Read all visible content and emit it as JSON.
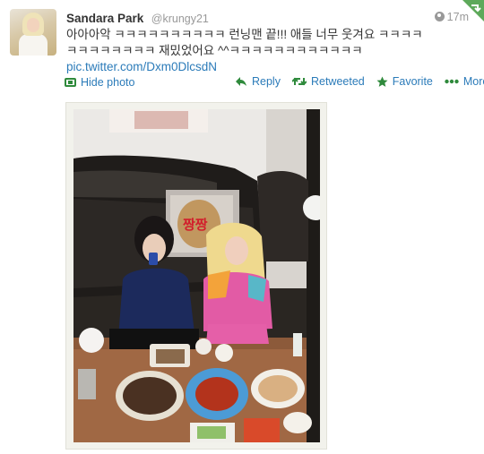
{
  "tweet": {
    "display_name": "Sandara Park",
    "screen_name": "@krungy21",
    "timestamp": "17m",
    "text_line1": "아아아악 ㅋㅋㅋㅋㅋㅋㅋㅋㅋㅋ 런닝맨 끝!!! 애들 너무 웃겨요 ㅋㅋㅋㅋ",
    "text_line2": "ㅋㅋㅋㅋㅋㅋㅋㅋ 재밌었어요 ^^ㅋㅋㅋㅋㅋㅋㅋㅋㅋㅋㅋㅋ",
    "link": "pic.twitter.com/Dxm0DlcsdN"
  },
  "photo_toggle": {
    "label": "Hide photo",
    "icon": "photo-icon"
  },
  "actions": [
    {
      "label": "Reply",
      "icon": "reply-arrow-icon",
      "color": "#2f8a3c"
    },
    {
      "label": "Retweeted",
      "icon": "retweet-icon",
      "color": "#2f8a3c"
    },
    {
      "label": "Favorite",
      "icon": "star-icon",
      "color": "#2f8a3c"
    },
    {
      "label": "More",
      "icon": "more-dots-icon",
      "color": "#2f8a3c"
    }
  ],
  "photo": {
    "description_icon": "photo-image",
    "sign_text": "짱짱"
  },
  "colors": {
    "link": "#2b7bb9",
    "action_icon": "#2f8a3c",
    "muted": "#999999",
    "corner_flag": "#5da95a"
  }
}
